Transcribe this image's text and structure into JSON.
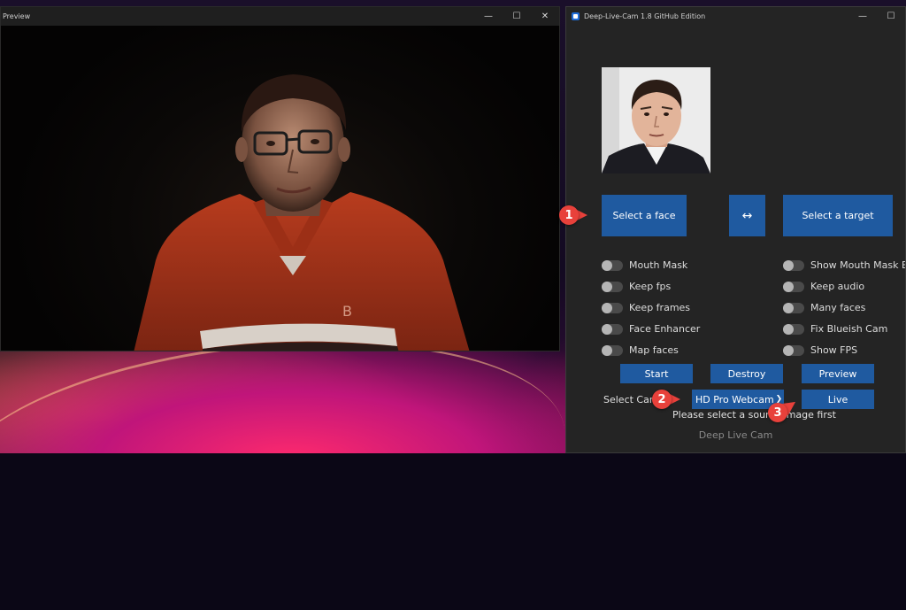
{
  "preview_window": {
    "title": "Preview",
    "controls": {
      "minimize": "—",
      "maximize": "☐",
      "close": "✕"
    }
  },
  "app_window": {
    "title": "Deep-Live-Cam 1.8 GitHub Edition",
    "controls": {
      "minimize": "—",
      "maximize": "☐"
    },
    "select_face_label": "Select a face",
    "swap_label": "↔",
    "select_target_label": "Select a target",
    "toggles_left": [
      {
        "label": "Mouth Mask",
        "enabled": false
      },
      {
        "label": "Keep fps",
        "enabled": false
      },
      {
        "label": "Keep frames",
        "enabled": false
      },
      {
        "label": "Face Enhancer",
        "enabled": false
      },
      {
        "label": "Map faces",
        "enabled": false
      }
    ],
    "toggles_right": [
      {
        "label": "Show Mouth Mask Bo",
        "enabled": false
      },
      {
        "label": "Keep audio",
        "enabled": false
      },
      {
        "label": "Many faces",
        "enabled": false
      },
      {
        "label": "Fix Blueish Cam",
        "enabled": false
      },
      {
        "label": "Show FPS",
        "enabled": false
      }
    ],
    "start_label": "Start",
    "destroy_label": "Destroy",
    "preview_label": "Preview",
    "select_camera_label": "Select Cam",
    "camera_value": "HD Pro Webcam",
    "live_label": "Live",
    "status_text": "Please select a source image first",
    "footer": "Deep Live Cam"
  },
  "annotations": {
    "marker1": "1",
    "marker2": "2",
    "marker3": "3"
  },
  "colors": {
    "accent_blue": "#1f5aa0",
    "marker_red": "#e8413b",
    "window_bg": "#242424"
  }
}
